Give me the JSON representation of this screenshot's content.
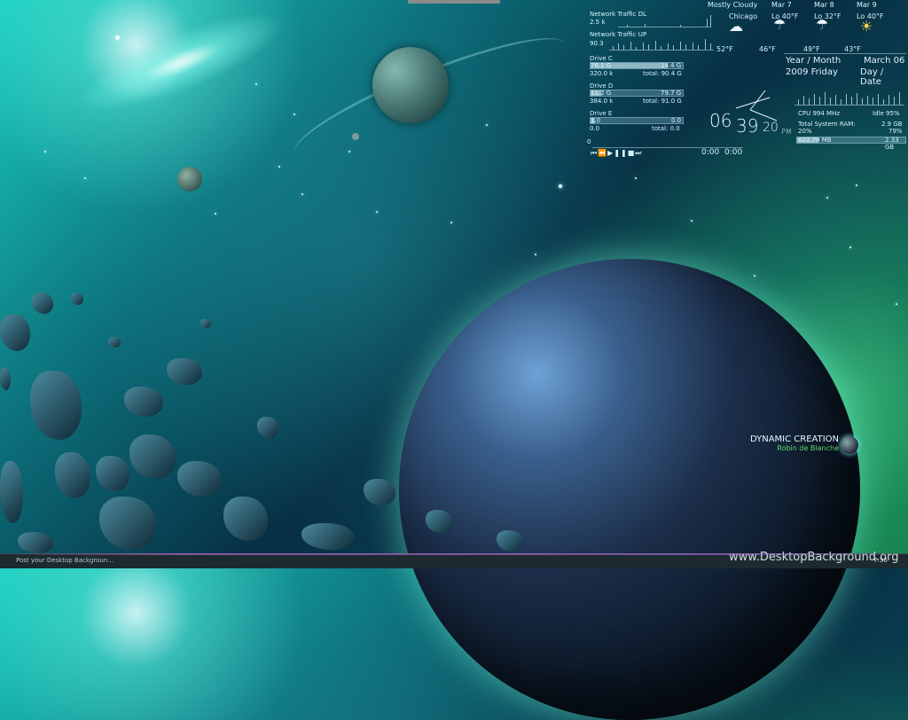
{
  "network": {
    "dl_label": "Network Traffic DL",
    "dl_value": "2.5 k",
    "up_label": "Network Traffic UP",
    "up_value": "90.3"
  },
  "drives": [
    {
      "label": "Drive C",
      "used": "76.1 G",
      "free": "14.4 G",
      "read": "320.0 k",
      "total": "total: 90.4 G",
      "fill": 0.84
    },
    {
      "label": "Drive D",
      "used": "11.2 G",
      "free": "79.7 G",
      "read": "384.0 k",
      "total": "total: 91.0 G",
      "fill": 0.12
    },
    {
      "label": "Drive E",
      "used": "1.0",
      "free": "0.0",
      "read": "0.0",
      "total": "total: 0.0",
      "fill": 0.05
    }
  ],
  "player": {
    "counter": "0",
    "time_a": "0:00",
    "time_b": "0:00",
    "controls": [
      "previous-icon",
      "rewind-icon",
      "play-icon",
      "pause-icon",
      "stop-icon",
      "next-icon"
    ]
  },
  "weather": {
    "condition": "Mostly Cloudy",
    "city": "Chicago",
    "current_temp": "52°F",
    "days": [
      {
        "date": "Mar 7",
        "lo": "Lo 40°F",
        "hi": "46°F",
        "icon": "rain-cloud-icon"
      },
      {
        "date": "Mar 8",
        "lo": "Lo 32°F",
        "hi": "49°F",
        "icon": "rain-cloud-icon"
      },
      {
        "date": "Mar 9",
        "lo": "Lo 40°F",
        "hi": "43°F",
        "icon": "sun-icon"
      }
    ]
  },
  "calendar": {
    "year_month_label": "Year / Month",
    "date_short": "March 06",
    "year_day": "2009 Friday",
    "day_date_label": "Day / Date"
  },
  "clock": {
    "hours": "06",
    "minutes": "39",
    "seconds": "20",
    "ampm": "PM"
  },
  "system": {
    "cpu_label": "CPU 994 MHz",
    "idle_label": "Idle 95%",
    "ram_label": "Total System RAM:",
    "ram_total": "2.9 GB",
    "ram_used_pct": "20%",
    "ram_free_pct": "79%",
    "ram_used": "622.79 MB",
    "ram_free": "2.33 GB"
  },
  "credits": {
    "title": "DYNAMIC CREATION",
    "author": "Robin de Blanche"
  },
  "footer": {
    "status_text": "Post your Desktop Backgroun...",
    "watermark": "www.DesktopBackground.org",
    "right_text": "7:36"
  },
  "colors": {
    "hud_text": "#d7f2ff",
    "credits_title": "#e6f8ff",
    "credits_author": "#62d66c"
  }
}
